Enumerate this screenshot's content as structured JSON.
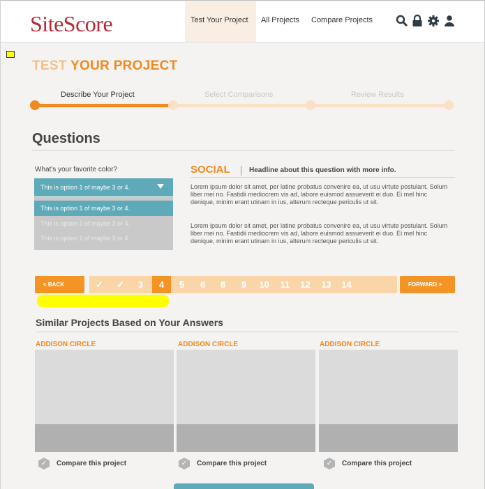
{
  "header": {
    "logo": "SiteScore",
    "nav": [
      "Test Your Project",
      "All Projects",
      "Compare Projects"
    ],
    "icons": [
      "search-icon",
      "lock-icon",
      "gear-icon",
      "user-icon"
    ]
  },
  "page": {
    "title_part1": "TEST",
    "title_part2": "YOUR PROJECT",
    "steps": [
      "Describe Your Project",
      "Select Comparisons",
      "Review Results"
    ]
  },
  "questions": {
    "title": "Questions",
    "label": "What's your favorite color?",
    "select_value": "This is option 1 of maybe 3 or 4.",
    "options": [
      "This is option 1 of maybe 3 or 4.",
      "This is option 1 of maybe 3 or 4.",
      "This is option 1 of maybe 3 or 4."
    ],
    "category": "SOCIAL",
    "headline": "Headline about this question with more info.",
    "paragraphs": [
      "Lorem ipsum dolor sit amet, per latine probatus convenire ea, ut usu virtute postulant. Solum liber mei no. Fastidii mediocrem vis ad, labore euismod assueverit ei duo. Ei mel hinc denique, minim erant utinam in ius, alterum recteque periculis ut sit.",
      "Lorem ipsum dolor sit amet, per latine probatus convenire ea, ut usu virtute postulant. Solum liber mei no. Fastidii mediocrem vis ad, labore euismod assueverit ei duo. Ei mel hinc denique, minim erant utinam in ius, alterum recteque periculis ut sit."
    ]
  },
  "pager": {
    "back": "< BACK",
    "forward": "FORWARD >",
    "pages": [
      "✓",
      "✓",
      "3",
      "4",
      "5",
      "6",
      "8",
      "9",
      "10",
      "11",
      "12",
      "13",
      "14",
      "",
      ""
    ]
  },
  "similar": {
    "title": "Similar Projects Based on Your Answers",
    "cards": [
      {
        "name": "ADDISON CIRCLE",
        "compare": "Compare this project"
      },
      {
        "name": "ADDISON CIRCLE",
        "compare": "Compare this project"
      },
      {
        "name": "ADDISON CIRCLE",
        "compare": "Compare this project"
      }
    ]
  },
  "colors": {
    "accent": "#f08a1e",
    "brand": "#b52a35",
    "teal": "#5eaab9"
  }
}
